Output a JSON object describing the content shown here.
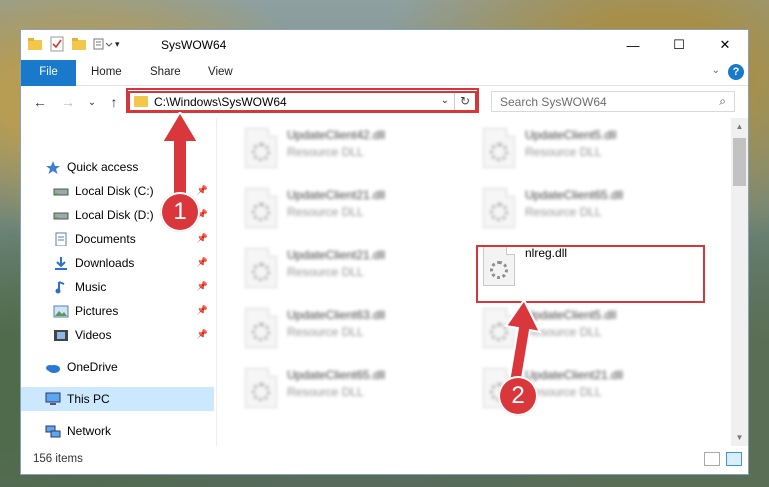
{
  "window": {
    "title": "SysWOW64",
    "controls": {
      "minimize": "—",
      "maximize": "☐",
      "close": "✕"
    }
  },
  "ribbon": {
    "tabs": [
      "File",
      "Home",
      "Share",
      "View"
    ],
    "help_label": "?",
    "collapse_label": "⌄"
  },
  "address": {
    "path": "C:\\Windows\\SysWOW64",
    "dropdown": "⌄",
    "refresh": "↻"
  },
  "search": {
    "placeholder": "Search SysWOW64",
    "icon": "⌕"
  },
  "nav_buttons": {
    "back": "←",
    "forward": "→",
    "recent": "⌄",
    "up": "↑"
  },
  "sidebar": {
    "items": [
      {
        "label": "Quick access",
        "icon": "star-icon",
        "pinned": false
      },
      {
        "label": "Local Disk (C:)",
        "icon": "drive-icon",
        "pinned": true
      },
      {
        "label": "Local Disk (D:)",
        "icon": "drive-icon",
        "pinned": true
      },
      {
        "label": "Documents",
        "icon": "documents-icon",
        "pinned": true
      },
      {
        "label": "Downloads",
        "icon": "download-icon",
        "pinned": true
      },
      {
        "label": "Music",
        "icon": "music-icon",
        "pinned": true
      },
      {
        "label": "Pictures",
        "icon": "pictures-icon",
        "pinned": true
      },
      {
        "label": "Videos",
        "icon": "videos-icon",
        "pinned": true
      },
      {
        "label": "OneDrive",
        "icon": "cloud-icon",
        "pinned": false
      },
      {
        "label": "This PC",
        "icon": "computer-icon",
        "pinned": false,
        "selected": true
      },
      {
        "label": "Network",
        "icon": "network-icon",
        "pinned": false
      }
    ]
  },
  "files": [
    {
      "name": "UpdateClient42.dll",
      "type": "Resource DLL"
    },
    {
      "name": "UpdateClient5.dll",
      "type": "Resource DLL"
    },
    {
      "name": "UpdateClient21.dll",
      "type": "Resource DLL"
    },
    {
      "name": "UpdateClient65.dll",
      "type": "Resource DLL"
    },
    {
      "name": "UpdateClient21.dll",
      "type": "Resource DLL"
    },
    {
      "name": "nlreg.dll",
      "type": ""
    },
    {
      "name": "UpdateClient63.dll",
      "type": "Resource DLL"
    },
    {
      "name": "UpdateClient5.dll",
      "type": "Resource DLL"
    },
    {
      "name": "UpdateClient65.dll",
      "type": "Resource DLL"
    },
    {
      "name": "UpdateClient21.dll",
      "type": "Resource DLL"
    }
  ],
  "status": {
    "item_count": "156 items"
  },
  "annotations": {
    "badge1": "1",
    "badge2": "2",
    "highlight_color": "#d5363a"
  }
}
